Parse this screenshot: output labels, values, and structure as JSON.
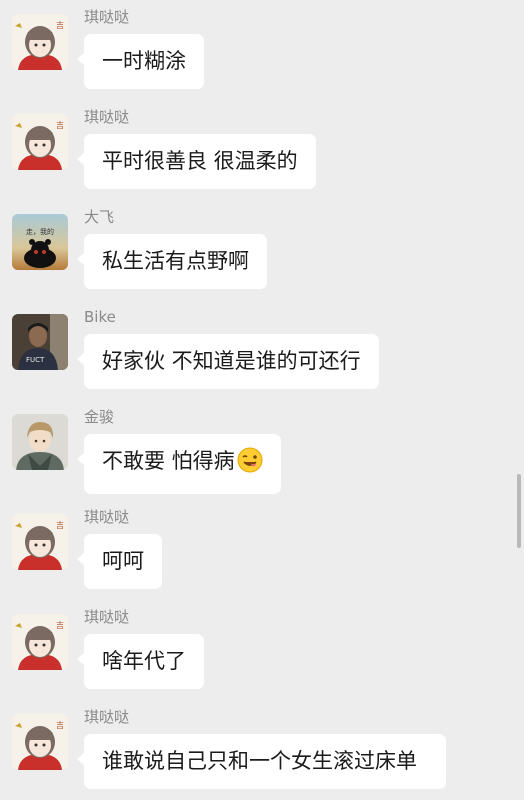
{
  "messages": [
    {
      "sender": "琪哒哒",
      "text": "一时糊涂",
      "avatar": "girl-cartoon-avatar"
    },
    {
      "sender": "琪哒哒",
      "text": "平时很善良 很温柔的",
      "avatar": "girl-cartoon-avatar"
    },
    {
      "sender": "大飞",
      "text": "私生活有点野啊",
      "avatar": "kumamon-avatar"
    },
    {
      "sender": "Bike",
      "text": "好家伙 不知道是谁的可还行",
      "avatar": "photo-person-avatar"
    },
    {
      "sender": "金骏",
      "text": "不敢要 怕得病",
      "avatar": "anime-boy-avatar",
      "emoji": "wink-tongue-emoji"
    },
    {
      "sender": "琪哒哒",
      "text": "呵呵",
      "avatar": "girl-cartoon-avatar"
    },
    {
      "sender": "琪哒哒",
      "text": "啥年代了",
      "avatar": "girl-cartoon-avatar"
    },
    {
      "sender": "琪哒哒",
      "text": "谁敢说自己只和一个女生滚过床单",
      "avatar": "girl-cartoon-avatar"
    }
  ],
  "avatar_text": {
    "girl_glyph": "吉",
    "kumamon_caption": "走，我的",
    "photo_caption": "FUCT"
  },
  "colors": {
    "background": "#ededed",
    "bubble": "#ffffff",
    "sender_name": "#8a8a8a",
    "text": "#1b1b1b"
  }
}
